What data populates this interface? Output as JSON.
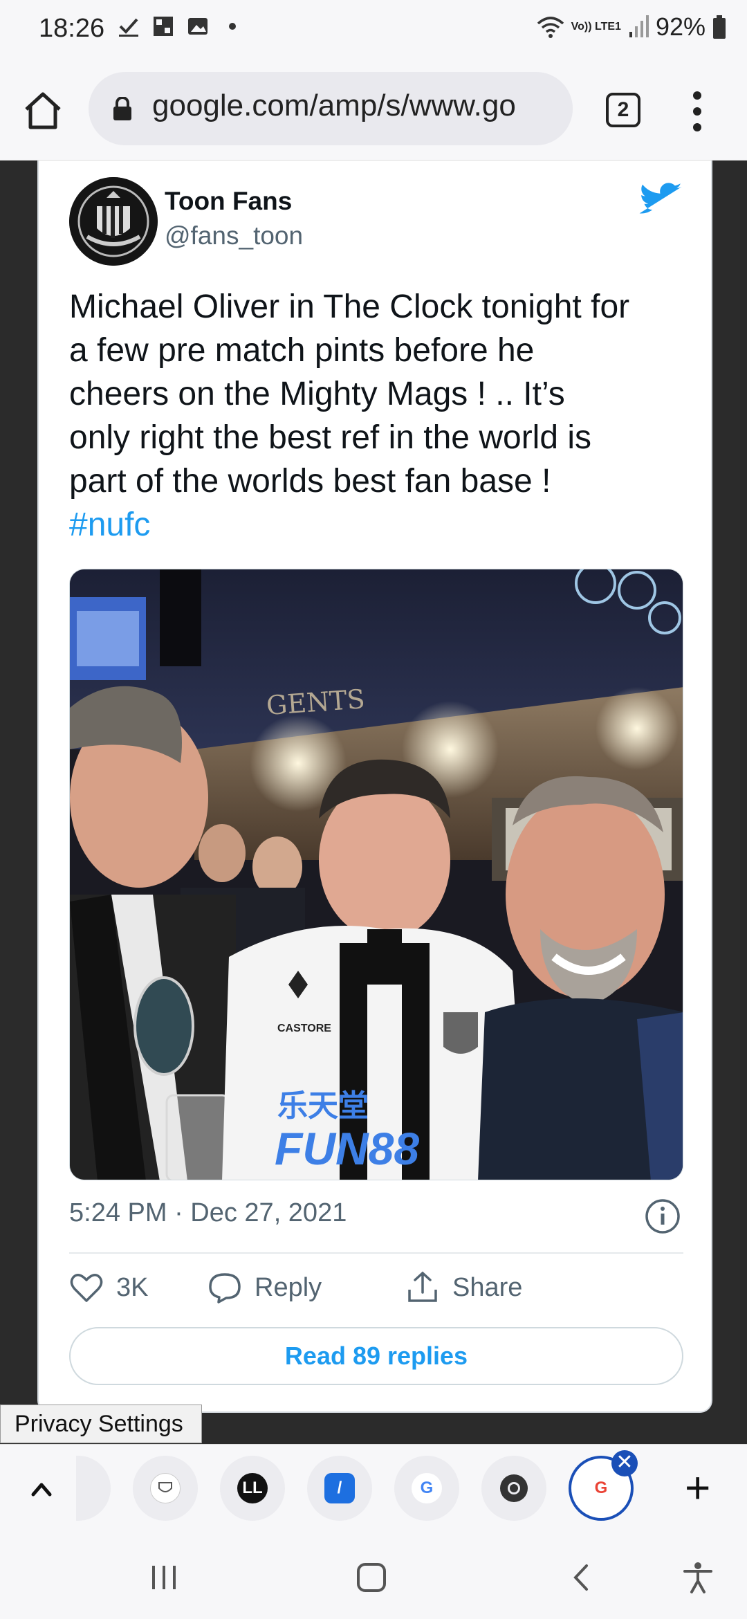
{
  "status_bar": {
    "time": "18:26",
    "battery": "92%",
    "network": "Vo)) LTE1"
  },
  "browser": {
    "url": "google.com/amp/s/www.go",
    "tab_count": "2"
  },
  "tweet": {
    "author_name": "Toon Fans",
    "author_handle": "@fans_toon",
    "text_lines": [
      "Michael Oliver in The Clock tonight for",
      "a few pre match pints before he",
      "cheers on the Mighty Mags ! .. It’s",
      "only right the best ref in the world is",
      "part of the worlds best fan base !"
    ],
    "hashtag": "#nufc",
    "photo_sign_text": "GENTS",
    "shirt_brand": "CASTORE",
    "shirt_sponsor_cn": "乐天堂",
    "shirt_sponsor": "FUN88",
    "timestamp": "5:24 PM · Dec 27, 2021",
    "likes": "3K",
    "reply_label": "Reply",
    "share_label": "Share",
    "read_replies": "Read 89 replies"
  },
  "privacy_settings": "Privacy Settings",
  "tab_strip": {
    "tabs": [
      "tab-partial",
      "mayo-clinic",
      "LL",
      "brand-tab",
      "google",
      "chrome",
      "google-active"
    ]
  },
  "colors": {
    "twitter_blue": "#1d9bf0",
    "chrome_active_blue": "#1a4fb7",
    "text_primary": "#0f1419",
    "text_secondary": "#536471"
  }
}
